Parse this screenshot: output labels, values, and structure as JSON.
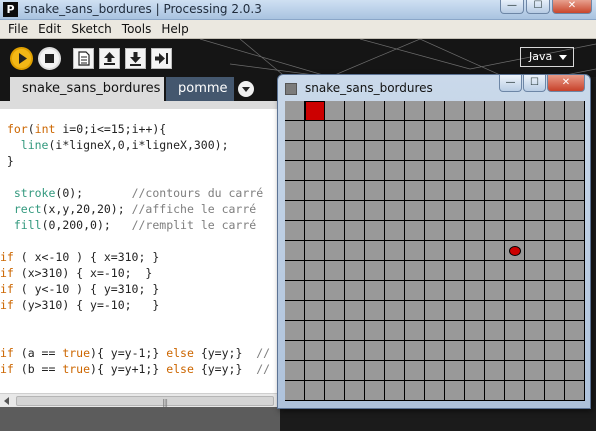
{
  "window": {
    "title": "snake_sans_bordures | Processing 2.0.3",
    "app_icon_letter": "P",
    "minimize": "—",
    "maximize": "☐",
    "close": "✕"
  },
  "menu": [
    "File",
    "Edit",
    "Sketch",
    "Tools",
    "Help"
  ],
  "toolbar": {
    "mode": "Java",
    "buttons": [
      "run",
      "stop",
      "new",
      "open",
      "save",
      "export"
    ]
  },
  "tabs": [
    {
      "label": "snake_sans_bordures",
      "active": true
    },
    {
      "label": "pomme",
      "active": false
    }
  ],
  "code": [
    " for(int i=0;i<=15;i++){",
    "   line(i*ligneX,0,i*ligneX,300);",
    " }",
    "",
    "  stroke(0);       //contours du carré",
    "  rect(x,y,20,20); //affiche le carré",
    "  fill(0,200,0);   //remplit le carré",
    "",
    "if ( x<-10 ) { x=310; }",
    "if (x>310) { x=-10;  }",
    "if ( y<-10 ) { y=310; }",
    "if (y>310) { y=-10;   }",
    "",
    "",
    "if (a == true){ y=y-1;} else {y=y;}  //",
    "if (b == true){ y=y+1;} else {y=y;}  //"
  ],
  "sketch_window": {
    "title": "snake_sans_bordures",
    "minimize": "—",
    "maximize": "☐",
    "close": "✕",
    "grid_rows": 15,
    "grid_cols": 15,
    "snake_cell": [
      0,
      1
    ],
    "apple_cell": [
      7,
      11
    ],
    "background_color": "#999999",
    "snake_color": "#cc0000",
    "apple_color": "#cc0000"
  },
  "scrollbar": {
    "grip": "|||"
  }
}
